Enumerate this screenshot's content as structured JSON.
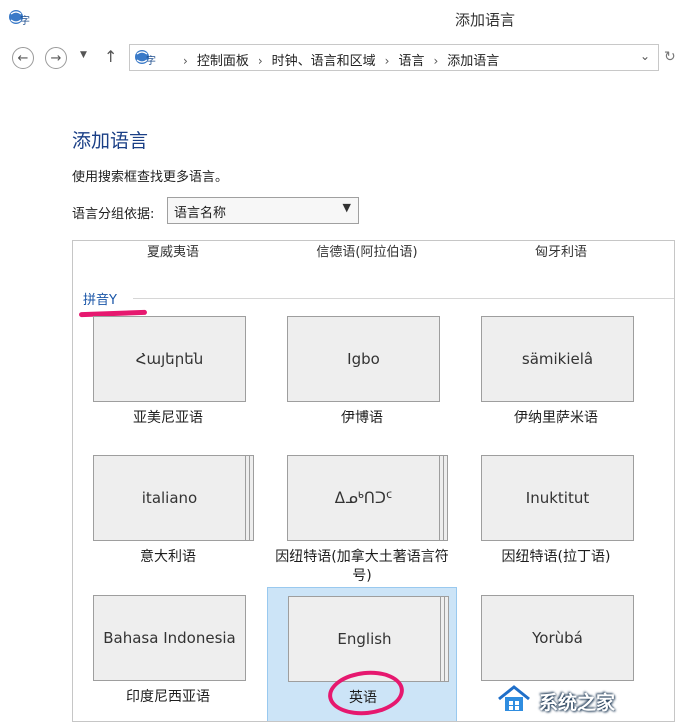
{
  "window": {
    "title": "添加语言"
  },
  "address_bar": {
    "crumbs": [
      "控制面板",
      "时钟、语言和区域",
      "语言",
      "添加语言"
    ]
  },
  "page": {
    "heading": "添加语言",
    "hint": "使用搜索框查找更多语言。",
    "group_label": "语言分组依据:",
    "group_value": "语言名称"
  },
  "languages_top_row": [
    "夏威夷语",
    "信德语(阿拉伯语)",
    "匈牙利语"
  ],
  "section_label": "拼音Y",
  "tiles": [
    {
      "native": "Հայերեն",
      "name": "亚美尼亚语"
    },
    {
      "native": "Igbo",
      "name": "伊博语"
    },
    {
      "native": "sämikielâ",
      "name": "伊纳里萨米语"
    },
    {
      "native": "italiano",
      "name": "意大利语"
    },
    {
      "native": "ᐃᓄᒃᑎᑐᑦ",
      "name": "因纽特语(加拿大土著语言符号)"
    },
    {
      "native": "Inuktitut",
      "name": "因纽特语(拉丁语)"
    },
    {
      "native": "Bahasa Indonesia",
      "name": "印度尼西亚语"
    },
    {
      "native": "English",
      "name": "英语"
    },
    {
      "native": "Yorùbá",
      "name": ""
    }
  ],
  "selected_tile": "English",
  "watermark": {
    "text": "系统之家"
  },
  "colors": {
    "heading": "#1a3f86",
    "highlight": "#cce4f7",
    "annotation": "#e6186f"
  }
}
